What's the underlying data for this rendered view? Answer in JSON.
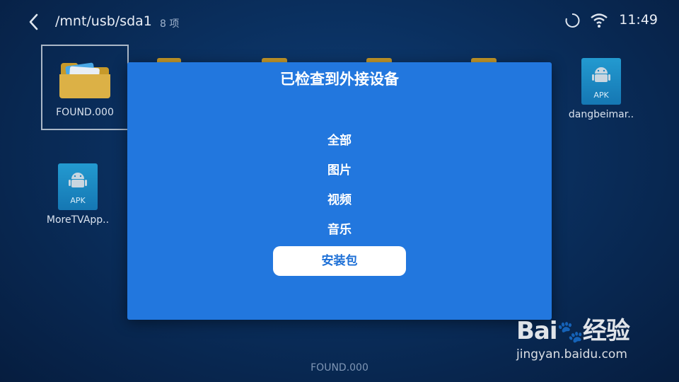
{
  "header": {
    "path": "/mnt/usb/sda1",
    "item_count": "8 项",
    "time": "11:49"
  },
  "files": [
    {
      "name": "FOUND.000",
      "type": "folder",
      "selected": true
    },
    {
      "name": "dangbeimar..",
      "type": "apk",
      "badge": "APK"
    },
    {
      "name": "MoreTVApp..",
      "type": "apk",
      "badge": "APK"
    }
  ],
  "dialog": {
    "title": "已检查到外接设备",
    "options": [
      "全部",
      "图片",
      "视频",
      "音乐",
      "安装包"
    ],
    "active_option": "安装包"
  },
  "footer": {
    "selected_name": "FOUND.000"
  },
  "watermark": {
    "url": "jingyan.baidu.com",
    "logo_text": "Bai 经验"
  },
  "colors": {
    "dialog_bg": "#2277de",
    "active_text": "#1c6fd6",
    "apk_bg": "#1c86c2"
  },
  "icons": [
    "back-arrow-icon",
    "loading-spinner-icon",
    "wifi-icon",
    "folder-icon",
    "android-icon"
  ]
}
